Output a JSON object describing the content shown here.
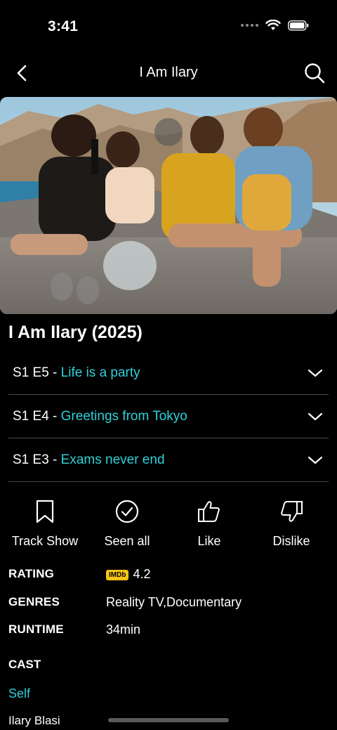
{
  "status": {
    "time": "3:41"
  },
  "nav": {
    "title": "I Am Ilary"
  },
  "hero": {
    "alt": ""
  },
  "show": {
    "title": "I Am Ilary (2025)"
  },
  "episodes": [
    {
      "code": "S1 E5",
      "name": "Life is a party"
    },
    {
      "code": "S1 E4",
      "name": "Greetings from Tokyo"
    },
    {
      "code": "S1 E3",
      "name": "Exams never end"
    }
  ],
  "actions": {
    "track": "Track Show",
    "seen": "Seen all",
    "like": "Like",
    "dislike": "Dislike"
  },
  "details": {
    "rating_label": "RATING",
    "imdb_badge": "IMDb",
    "rating_value": "4.2",
    "genres_label": "GENRES",
    "genres_value": "Reality TV,Documentary",
    "runtime_label": "RUNTIME",
    "runtime_value": "34min"
  },
  "cast": {
    "label": "CAST",
    "role": "Self",
    "name": "Ilary Blasi"
  },
  "colors": {
    "accent": "#2fd0d8",
    "imdb": "#f5c518",
    "divider": "#4a4a4a"
  }
}
